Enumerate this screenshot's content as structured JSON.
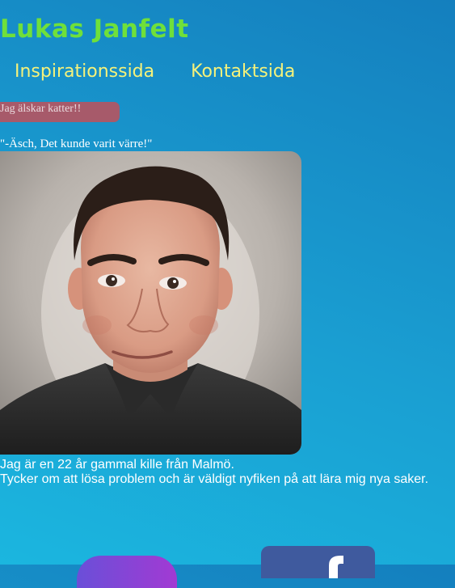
{
  "header": {
    "title": "Lukas Janfelt"
  },
  "nav": {
    "items": [
      {
        "label": "Inspirationssida"
      },
      {
        "label": "Kontaktsida"
      }
    ]
  },
  "banner": {
    "text": "Jag älskar katter!!"
  },
  "quote": {
    "text": "\"-Äsch, Det kunde varit värre!\""
  },
  "bio": {
    "line1": "Jag är en 22 år gammal kille från Malmö.",
    "line2": "Tycker om att lösa problem och är väldigt nyfiken på att lära mig nya saker."
  },
  "social": {
    "icons": [
      "instagram-icon",
      "facebook-icon"
    ]
  },
  "colors": {
    "title": "#6fe03a",
    "nav": "#f6f27a",
    "banner": "#a75a6a",
    "background_start": "#1bb6df",
    "background_end": "#147fbe"
  }
}
